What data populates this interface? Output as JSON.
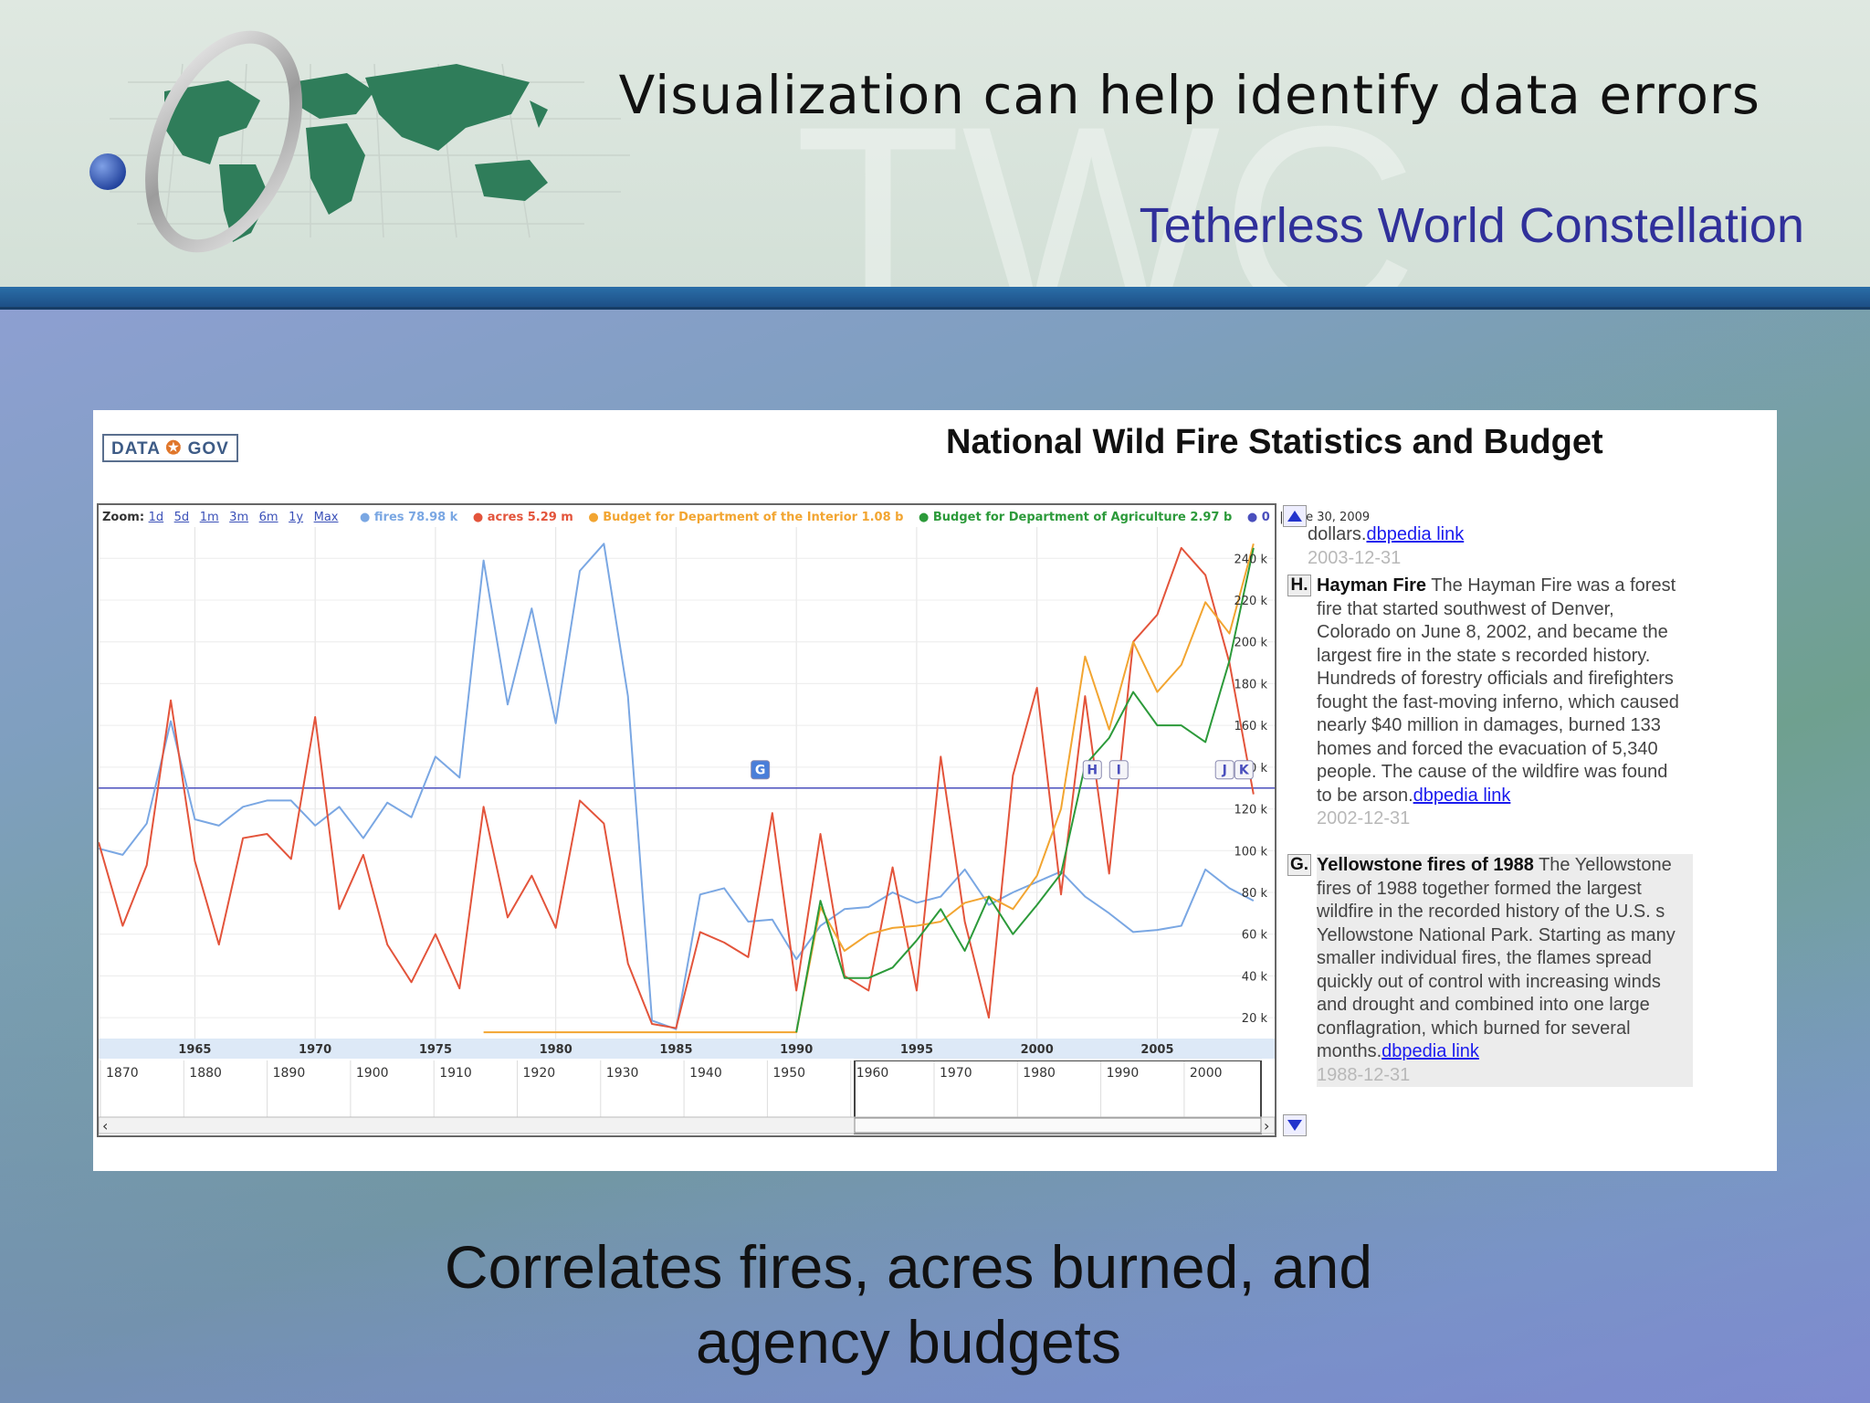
{
  "slide": {
    "title": "Visualization can help identify data errors",
    "org_name": "Tetherless World Constellation",
    "watermark": "TWC",
    "caption_line1": "Correlates fires, acres burned, and",
    "caption_line2": "agency budgets"
  },
  "app": {
    "logo_left": "DATA",
    "logo_right": "GOV",
    "title": "National Wild Fire Statistics and Budget"
  },
  "zoom": {
    "label": "Zoom:",
    "options": [
      "1d",
      "5d",
      "1m",
      "3m",
      "6m",
      "1y",
      "Max"
    ]
  },
  "legend": {
    "fires": "fires 78.98 k",
    "acres": "acres 5.29 m",
    "interior": "Budget for Department of the Interior 1.08 b",
    "agriculture": "Budget for Department of Agriculture 2.97 b",
    "zero": "0",
    "date": "| June 30, 2009"
  },
  "colors": {
    "fires": "#7aa7e3",
    "acres": "#e3543b",
    "interior": "#f2a531",
    "agriculture": "#2c9a3a",
    "marker_line": "#4a4fbd",
    "accent_blue": "#30309a"
  },
  "events": {
    "top": {
      "text": "dollars.",
      "link": "dbpedia link",
      "date": "2003-12-31"
    },
    "h": {
      "letter": "H.",
      "title": "Hayman Fire",
      "body": " The Hayman Fire was a forest fire that started southwest of Denver, Colorado on June 8, 2002, and became the largest fire in the state s recorded history. Hundreds of forestry officials and firefighters fought the fast-moving inferno, which caused nearly $40 million in damages, burned 133 homes and forced the evacuation of 5,340 people. The cause of the wildfire was found to be arson.",
      "link": "dbpedia link",
      "date": "2002-12-31"
    },
    "g": {
      "letter": "G.",
      "title": "Yellowstone fires of 1988",
      "body": " The Yellowstone fires of 1988 together formed the largest wildfire in the recorded history of the U.S. s Yellowstone National Park. Starting as many smaller individual fires, the flames spread quickly out of control with increasing winds and drought and combined into one large conflagration, which burned for several months.",
      "link": "dbpedia link",
      "date": "1988-12-31"
    }
  },
  "chart_data": {
    "type": "line",
    "x_ticks": [
      "1965",
      "1970",
      "1975",
      "1980",
      "1985",
      "1990",
      "1995",
      "2000",
      "2005"
    ],
    "y_ticks": [
      "20 k",
      "40 k",
      "60 k",
      "80 k",
      "100 k",
      "120 k",
      "140 k",
      "160 k",
      "180 k",
      "200 k",
      "220 k",
      "240 k"
    ],
    "xlim": [
      1961,
      2009.5
    ],
    "ylim": [
      10000,
      255000
    ],
    "series": [
      {
        "name": "fires",
        "x": [
          1961,
          1962,
          1963,
          1964,
          1965,
          1966,
          1967,
          1968,
          1969,
          1970,
          1971,
          1972,
          1973,
          1974,
          1975,
          1976,
          1977,
          1978,
          1979,
          1980,
          1981,
          1982,
          1983,
          1984,
          1985,
          1986,
          1987,
          1988,
          1989,
          1990,
          1991,
          1992,
          1993,
          1994,
          1995,
          1996,
          1997,
          1998,
          1999,
          2000,
          2001,
          2002,
          2003,
          2004,
          2005,
          2006,
          2007,
          2008,
          2009
        ],
        "values": [
          101000,
          98000,
          113000,
          162000,
          115000,
          112000,
          121000,
          124000,
          124000,
          112000,
          121000,
          106000,
          123000,
          116000,
          145000,
          135000,
          239000,
          170000,
          216000,
          161000,
          234000,
          247000,
          174000,
          18600,
          14500,
          79000,
          82000,
          66000,
          67000,
          48000,
          64000,
          72000,
          73000,
          80000,
          75000,
          78000,
          91000,
          74000,
          80000,
          85000,
          90000,
          78000,
          70000,
          61000,
          62000,
          64000,
          91000,
          82000,
          76000
        ]
      },
      {
        "name": "acres",
        "x": [
          1961,
          1962,
          1963,
          1964,
          1965,
          1966,
          1967,
          1968,
          1969,
          1970,
          1971,
          1972,
          1973,
          1974,
          1975,
          1976,
          1977,
          1978,
          1979,
          1980,
          1981,
          1982,
          1983,
          1984,
          1985,
          1986,
          1987,
          1988,
          1989,
          1990,
          1991,
          1992,
          1993,
          1994,
          1995,
          1996,
          1997,
          1998,
          1999,
          2000,
          2001,
          2002,
          2003,
          2004,
          2005,
          2006,
          2007,
          2008,
          2009
        ],
        "values": [
          104000,
          64000,
          93000,
          172000,
          95000,
          55000,
          106000,
          108000,
          96000,
          164000,
          72000,
          98000,
          55000,
          37000,
          60000,
          34000,
          121000,
          68000,
          88000,
          63000,
          124000,
          113000,
          46000,
          17000,
          15000,
          61000,
          56000,
          49000,
          118000,
          33000,
          108000,
          40000,
          33000,
          92000,
          33000,
          145000,
          66000,
          20000,
          136000,
          178000,
          79000,
          174000,
          89000,
          200000,
          213000,
          245000,
          232000,
          190000,
          127000
        ]
      },
      {
        "name": "Budget for Department of the Interior",
        "x": [
          1977,
          1978,
          1979,
          1980,
          1981,
          1982,
          1983,
          1984,
          1985,
          1986,
          1987,
          1988,
          1989,
          1990,
          1991,
          1992,
          1993,
          1994,
          1995,
          1996,
          1997,
          1998,
          1999,
          2000,
          2001,
          2002,
          2003,
          2004,
          2005,
          2006,
          2007,
          2008,
          2009
        ],
        "values": [
          13000,
          13000,
          13000,
          13000,
          13000,
          13000,
          13000,
          13000,
          13000,
          13000,
          13000,
          13000,
          13000,
          13000,
          73000,
          52000,
          60000,
          63000,
          64000,
          66000,
          75000,
          78000,
          72000,
          88000,
          120000,
          193000,
          158000,
          200000,
          176000,
          189000,
          219000,
          204000,
          247000
        ]
      },
      {
        "name": "Budget for Department of Agriculture",
        "x": [
          1990,
          1991,
          1992,
          1993,
          1994,
          1995,
          1996,
          1997,
          1998,
          1999,
          2000,
          2001,
          2002,
          2003,
          2004,
          2005,
          2006,
          2007,
          2008,
          2009
        ],
        "values": [
          13000,
          76000,
          39000,
          39000,
          44000,
          57000,
          72000,
          52000,
          78000,
          60000,
          74000,
          89000,
          141000,
          154000,
          176000,
          160000,
          160000,
          152000,
          191000,
          245000
        ]
      }
    ],
    "markers": [
      {
        "label": "G",
        "x": 1988.5
      },
      {
        "label": "H",
        "x": 2002.3
      },
      {
        "label": "I",
        "x": 2003.4
      },
      {
        "label": "J",
        "x": 2007.8
      },
      {
        "label": "K",
        "x": 2008.6
      }
    ],
    "reference_line_y": 130000,
    "navigator": {
      "ticks": [
        "1870",
        "1880",
        "1890",
        "1900",
        "1910",
        "1920",
        "1930",
        "1940",
        "1950",
        "1960",
        "1970",
        "1980",
        "1990",
        "2000"
      ]
    },
    "grid": true,
    "legend_position": "top"
  }
}
